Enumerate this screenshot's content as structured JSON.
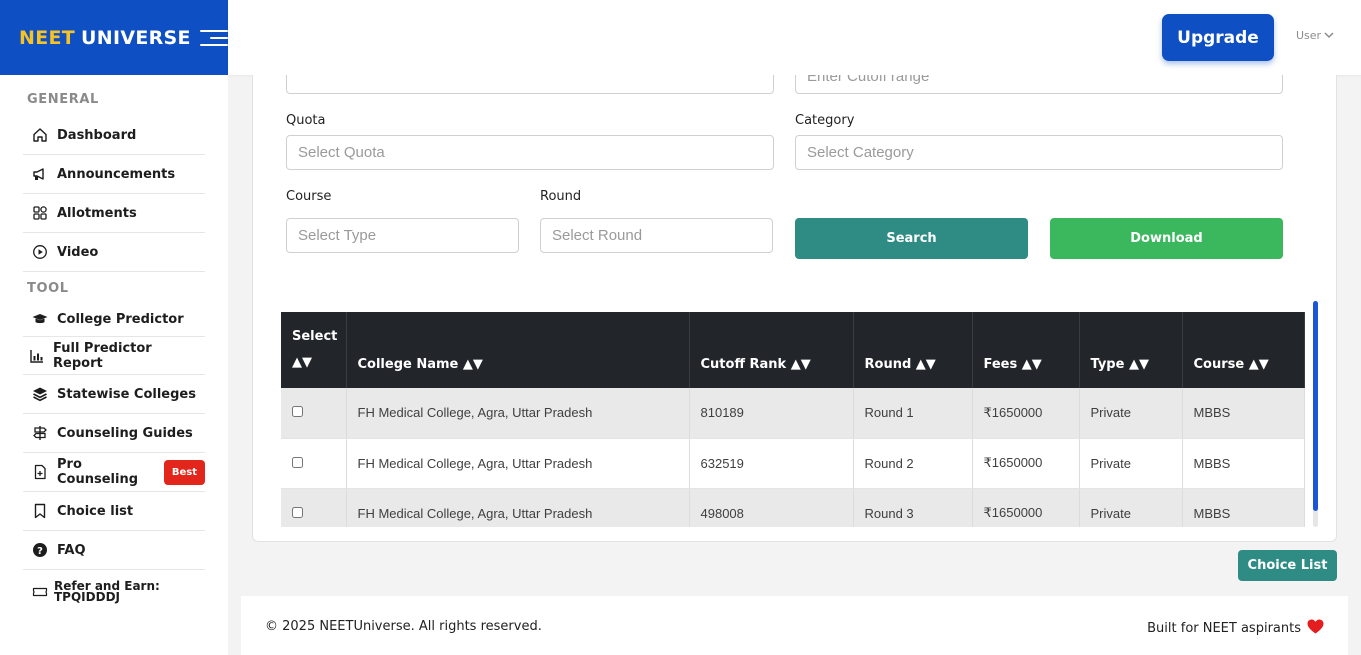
{
  "brand": {
    "part1": "NEET",
    "part2": "UNIVERSE"
  },
  "sidebar": {
    "general_label": "GENERAL",
    "general_items": [
      {
        "label": "Dashboard"
      },
      {
        "label": "Announcements"
      },
      {
        "label": "Allotments"
      },
      {
        "label": "Video"
      }
    ],
    "tool_label": "TOOL",
    "tool_items": [
      {
        "label": "College Predictor"
      },
      {
        "label": "Full Predictor Report"
      },
      {
        "label": "Statewise Colleges"
      },
      {
        "label": "Counseling Guides"
      },
      {
        "label": "Pro Counseling",
        "badge": "Best"
      },
      {
        "label": "Choice list"
      },
      {
        "label": "FAQ"
      },
      {
        "label": "Refer and Earn: TPQIDDDJ"
      }
    ]
  },
  "topbar": {
    "upgrade_label": "Upgrade",
    "user_label": "User"
  },
  "filters": {
    "top_left_placeholder": "",
    "cutoff_placeholder": "Enter Cutoff range",
    "quota_label": "Quota",
    "quota_placeholder": "Select Quota",
    "category_label": "Category",
    "category_placeholder": "Select Category",
    "course_label": "Course",
    "course_placeholder": "Select Type",
    "round_label": "Round",
    "round_placeholder": "Select Round",
    "search_label": "Search",
    "download_label": "Download"
  },
  "table": {
    "headers": [
      "Select ▲▼",
      "College Name ▲▼",
      "Cutoff Rank ▲▼",
      "Round ▲▼",
      "Fees ▲▼",
      "Type ▲▼",
      "Course ▲▼"
    ],
    "rows": [
      {
        "college": "FH Medical College, Agra, Uttar Pradesh",
        "cutoff": "810189",
        "round": "Round 1",
        "fees": "₹1650000",
        "type": "Private",
        "course": "MBBS"
      },
      {
        "college": "FH Medical College, Agra, Uttar Pradesh",
        "cutoff": "632519",
        "round": "Round 2",
        "fees": "₹1650000",
        "type": "Private",
        "course": "MBBS"
      },
      {
        "college": "FH Medical College, Agra, Uttar Pradesh",
        "cutoff": "498008",
        "round": "Round 3",
        "fees": "₹1650000",
        "type": "Private",
        "course": "MBBS"
      }
    ]
  },
  "choice_list_label": "Choice List",
  "footer": {
    "copyright": "© 2025 NEETUniverse. All rights reserved.",
    "tagline": "Built for NEET aspirants"
  },
  "colors": {
    "brand_blue": "#0f4fc4",
    "brand_yellow": "#f6c323",
    "search_teal": "#2f8c84",
    "download_green": "#3bb75e",
    "badge_red": "#e2261c",
    "table_header": "#222529"
  }
}
